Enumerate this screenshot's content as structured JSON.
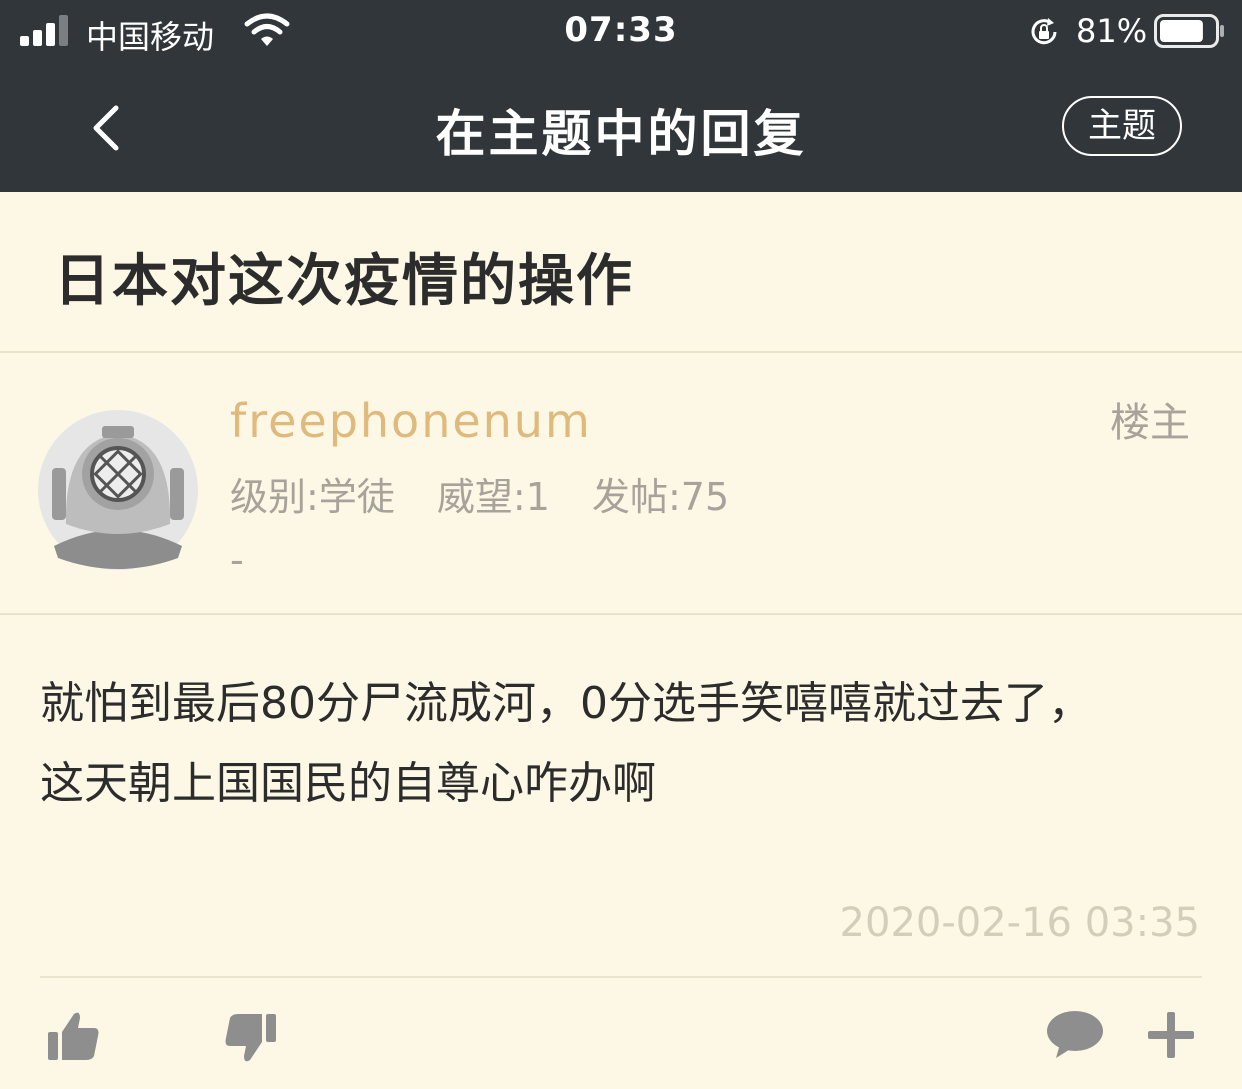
{
  "status_bar": {
    "carrier": "中国移动",
    "time": "07:33",
    "battery_percent": "81%",
    "battery_level": 0.81
  },
  "nav": {
    "title": "在主题中的回复",
    "topic_button": "主题"
  },
  "thread": {
    "title": "日本对这次疫情的操作"
  },
  "post": {
    "username": "freephonenum",
    "badge": "楼主",
    "level": "级别:学徒",
    "prestige": "威望:1",
    "posts": "发帖:75",
    "signature": "-",
    "content_line1": "就怕到最后80分尸流成河，0分选手笑嘻嘻就过去了，",
    "content_line2": "这天朝上国国民的自尊心咋办啊",
    "timestamp": "2020-02-16 03:35"
  },
  "icons": {
    "like": "thumbs-up-icon",
    "dislike": "thumbs-down-icon",
    "comment": "comment-icon",
    "more": "plus-icon"
  },
  "colors": {
    "header_bg": "#31363a",
    "page_bg": "#fdf8e6",
    "username": "#e0b97c",
    "muted": "#a7a29a"
  }
}
